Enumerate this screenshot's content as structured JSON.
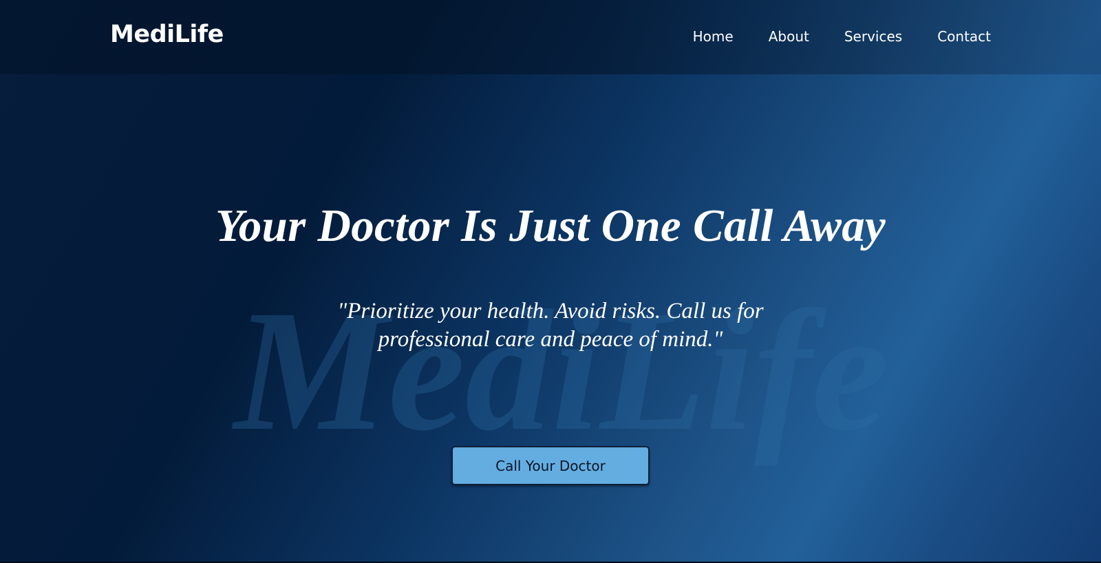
{
  "brand": {
    "name": "MediLife"
  },
  "nav": {
    "items": [
      {
        "label": "Home"
      },
      {
        "label": "About"
      },
      {
        "label": "Services"
      },
      {
        "label": "Contact"
      }
    ]
  },
  "hero": {
    "title": "Your Doctor Is Just One Call Away",
    "subtitle": "\"Prioritize your health. Avoid risks. Call us for professional care and peace of mind.\"",
    "watermark": "MediLife",
    "cta_label": "Call Your Doctor"
  },
  "colors": {
    "background_dark": "#031b3a",
    "background_light": "#22609a",
    "cta_background": "#63ade1",
    "text": "#ffffff"
  }
}
